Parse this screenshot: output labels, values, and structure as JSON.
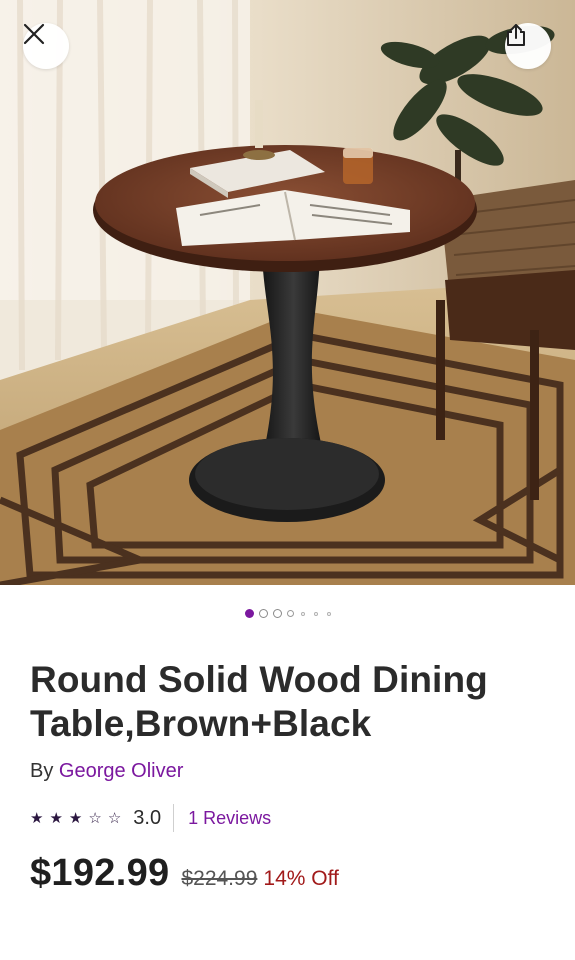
{
  "colors": {
    "accent": "#7b189f",
    "discount": "#a11a1a",
    "text": "#2b2b2b"
  },
  "icons": {
    "close": "close-icon",
    "share": "share-icon"
  },
  "carousel": {
    "total_dots": 7,
    "active_index": 0
  },
  "product": {
    "title": "Round Solid Wood Dining Table,Brown+Black",
    "by_label": "By",
    "brand": "George Oliver",
    "rating": {
      "stars_filled": 3,
      "stars_total": 5,
      "value": "3.0",
      "reviews_label": "1 Reviews"
    },
    "price": {
      "current": "$192.99",
      "original": "$224.99",
      "discount": "14% Off"
    }
  }
}
